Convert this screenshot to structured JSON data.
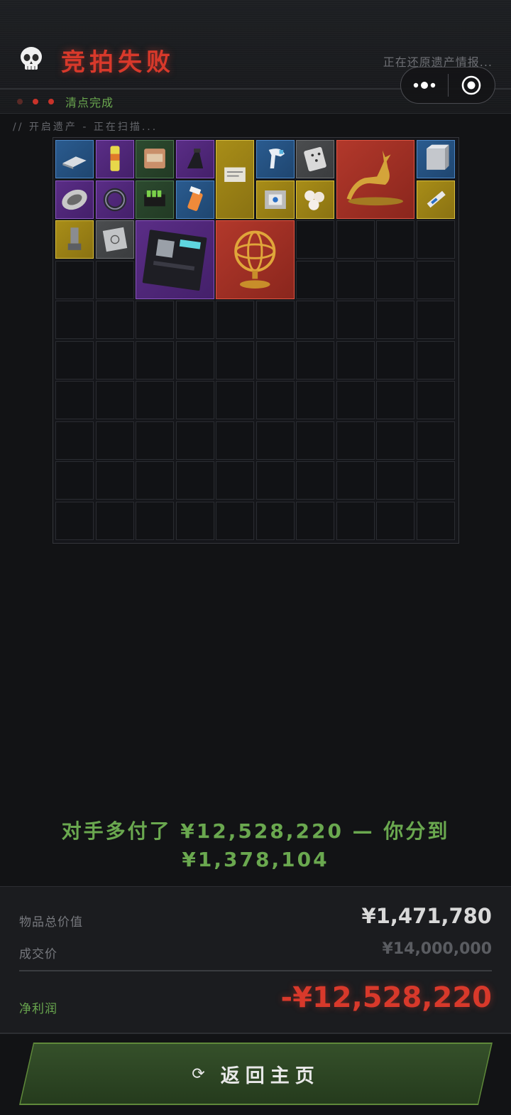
{
  "header": {
    "title": "竞拍失败",
    "subtitle": "正在还原遗产情报...",
    "status_label": "清点完成",
    "status_dot_colors": [
      "#5a2a26",
      "#c9332a",
      "#c9332a"
    ],
    "scan_text": "// 开启遗产 - 正在扫描...",
    "icons": [
      "skull-icon",
      "more-dots-icon",
      "close-target-icon"
    ]
  },
  "grid": {
    "columns": 10,
    "rows": 10,
    "items": [
      {
        "name": "aluminum-ingot",
        "rarity": "blue"
      },
      {
        "name": "energy-drink-can",
        "rarity": "purple"
      },
      {
        "name": "snack-bag",
        "rarity": "green"
      },
      {
        "name": "phone-stand",
        "rarity": "purple"
      },
      {
        "name": "documents",
        "rarity": "gold"
      },
      {
        "name": "ir-thermometer",
        "rarity": "blue"
      },
      {
        "name": "playing-cards",
        "rarity": "gray"
      },
      {
        "name": "golden-deer-statue",
        "rarity": "red"
      },
      {
        "name": "server-block",
        "rarity": "blue"
      },
      {
        "name": "stone-egg",
        "rarity": "purple"
      },
      {
        "name": "smart-ring",
        "rarity": "purple"
      },
      {
        "name": "battery-pack",
        "rarity": "green"
      },
      {
        "name": "pill-bottle",
        "rarity": "blue"
      },
      {
        "name": "cpu-chip",
        "rarity": "gold"
      },
      {
        "name": "pearls",
        "rarity": "gold"
      },
      {
        "name": "usb-drive",
        "rarity": "gold"
      },
      {
        "name": "inhaler",
        "rarity": "gold"
      },
      {
        "name": "metal-plate",
        "rarity": "gray"
      },
      {
        "name": "motherboard",
        "rarity": "purple"
      },
      {
        "name": "armillary-sphere",
        "rarity": "red"
      }
    ]
  },
  "result": {
    "line1": "对手多付了 ¥12,528,220 — 你分到",
    "line2": "¥1,378,104"
  },
  "summary": {
    "total_label": "物品总价值",
    "total_value": "¥1,471,780",
    "deal_label": "成交价",
    "deal_value": "¥14,000,000",
    "profit_label": "净利润",
    "profit_value": "-¥12,528,220"
  },
  "button": {
    "label": "返回主页",
    "icon": "refresh-icon"
  },
  "colors": {
    "fail_red": "#d8392b",
    "success_green": "#6aa84f",
    "background": "#121315"
  }
}
